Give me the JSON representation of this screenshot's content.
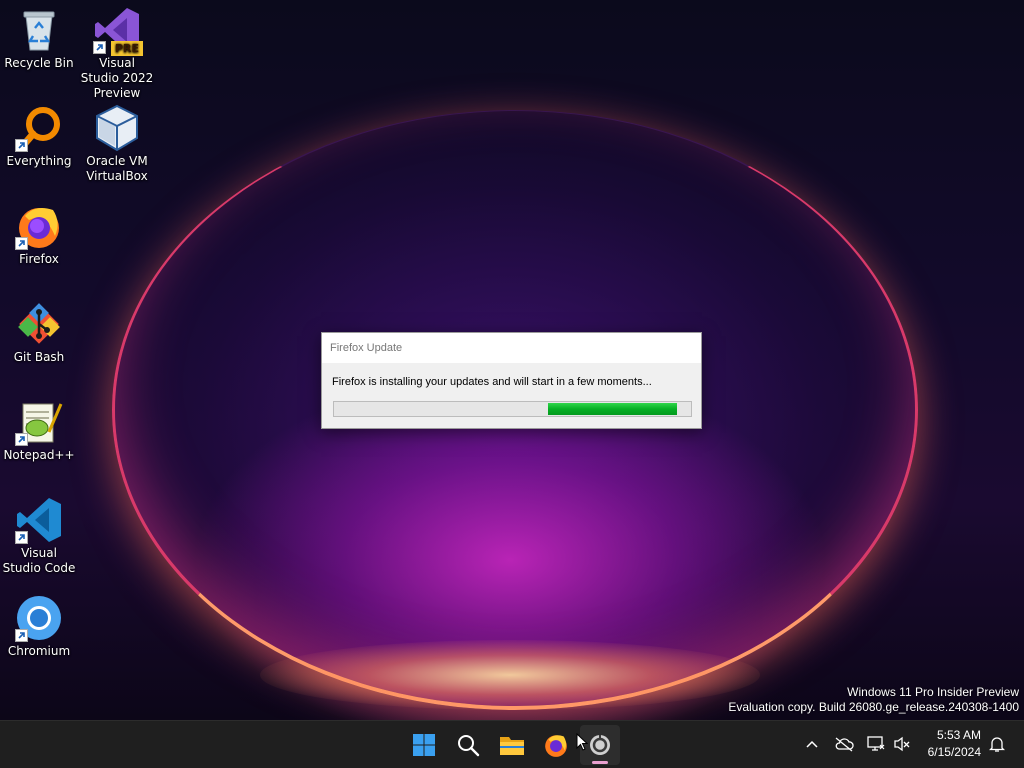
{
  "desktop": {
    "icons": [
      {
        "label": "Recycle Bin"
      },
      {
        "label": "Visual Studio 2022 Preview",
        "badge": "PRE"
      },
      {
        "label": "Everything"
      },
      {
        "label": "Oracle VM VirtualBox"
      },
      {
        "label": "Firefox"
      },
      {
        "label": "Git Bash"
      },
      {
        "label": "Notepad++"
      },
      {
        "label": "Visual Studio Code"
      },
      {
        "label": "Chromium"
      }
    ],
    "watermark": {
      "line1": "Windows 11 Pro Insider Preview",
      "line2": "Evaluation copy. Build 26080.ge_release.240308-1400"
    }
  },
  "dialog": {
    "title": "Firefox Update",
    "message": "Firefox is installing your updates and will start in a few moments...",
    "progress": {
      "segment_start": 0.6,
      "segment_end": 0.96,
      "color": "#06b025",
      "state": "indeterminate"
    }
  },
  "taskbar": {
    "apps": [
      {
        "name": "start",
        "icon": "windows-logo-icon"
      },
      {
        "name": "search",
        "icon": "search-icon"
      },
      {
        "name": "file-explorer",
        "icon": "folder-icon"
      },
      {
        "name": "firefox",
        "icon": "firefox-icon"
      },
      {
        "name": "firefox-updater",
        "icon": "updater-icon",
        "active": true
      }
    ],
    "tray": {
      "icons": [
        "chevron-up-icon",
        "cloud-offline-icon",
        "network-icon",
        "volume-muted-icon",
        "notification-bell-icon"
      ],
      "time": "5:53 AM",
      "date": "6/15/2024"
    }
  },
  "colors": {
    "taskbar_bg": "#1f1f1f",
    "progress_green": "#06b025",
    "dialog_bg": "#f0f0f0"
  }
}
